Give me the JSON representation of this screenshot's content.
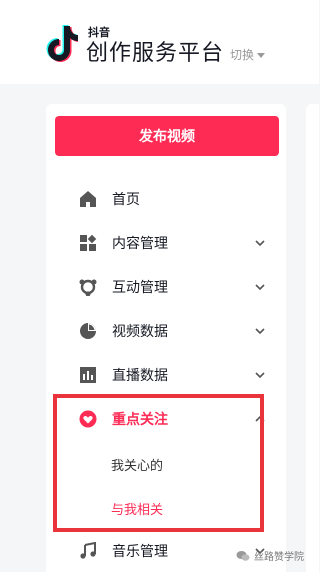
{
  "header": {
    "brand_small": "抖音",
    "brand_title": "创作服务平台",
    "switch_label": "切换"
  },
  "sidebar": {
    "publish_label": "发布视频",
    "items": [
      {
        "label": "首页",
        "icon": "home-icon",
        "chevron": false,
        "active": false
      },
      {
        "label": "内容管理",
        "icon": "content-icon",
        "chevron": true,
        "active": false
      },
      {
        "label": "互动管理",
        "icon": "interaction-icon",
        "chevron": true,
        "active": false
      },
      {
        "label": "视频数据",
        "icon": "pie-chart-icon",
        "chevron": true,
        "active": false
      },
      {
        "label": "直播数据",
        "icon": "bar-chart-icon",
        "chevron": true,
        "active": false
      },
      {
        "label": "重点关注",
        "icon": "heart-icon",
        "chevron": true,
        "active": true,
        "expanded": true
      },
      {
        "label": "音乐管理",
        "icon": "music-note-icon",
        "chevron": true,
        "active": false
      }
    ],
    "sub_items": [
      {
        "label": "我关心的",
        "color": "#333333"
      },
      {
        "label": "与我相关",
        "color": "#fe2c55"
      }
    ]
  },
  "watermark": {
    "text": "丝路赞学院"
  },
  "colors": {
    "accent": "#fe2c55",
    "highlight_border": "#e8343a",
    "icon_gray": "#555555"
  }
}
